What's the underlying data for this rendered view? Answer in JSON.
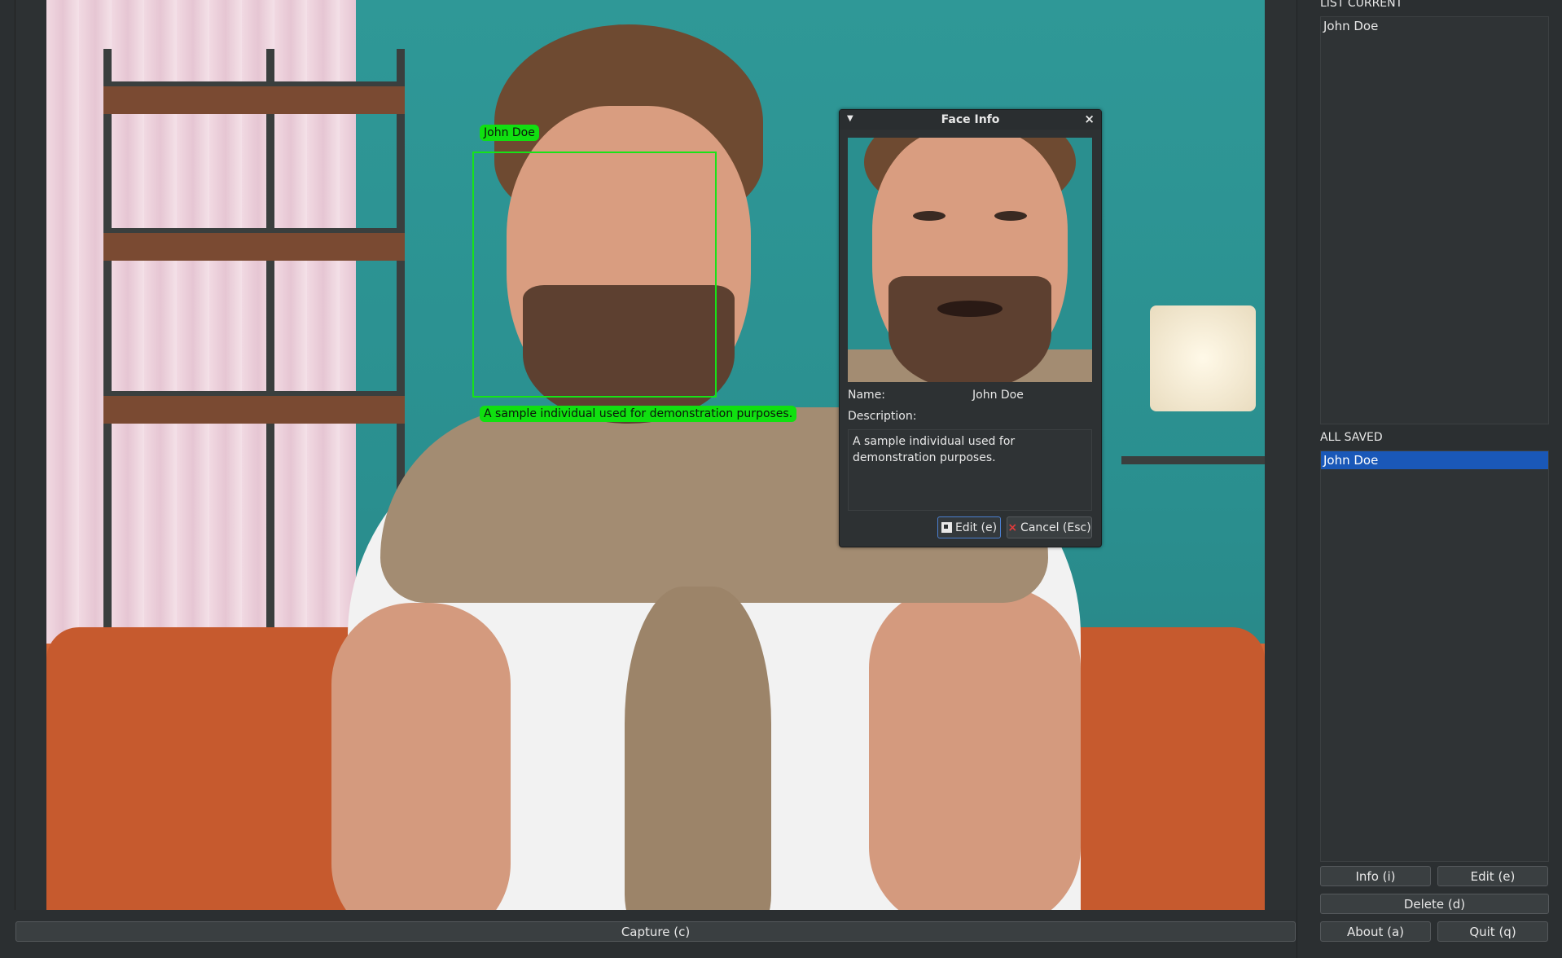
{
  "video": {
    "overlay_name": "John Doe",
    "overlay_desc": "A sample individual used for demonstration purposes."
  },
  "capture": {
    "label": "Capture (c)"
  },
  "panel": {
    "list_current_label": "LIST CURRENT",
    "list_current": [
      "John Doe"
    ],
    "all_saved_label": "ALL SAVED",
    "all_saved": [
      {
        "name": "John Doe",
        "selected": true
      }
    ],
    "buttons": {
      "info": "Info (i)",
      "edit": "Edit (e)",
      "delete": "Delete (d)",
      "about": "About (a)",
      "quit": "Quit (q)"
    }
  },
  "dialog": {
    "title": "Face Info",
    "name_label": "Name:",
    "name_value": "John Doe",
    "description_label": "Description:",
    "description_value": "A sample individual used for demonstration purposes.",
    "edit_button": "Edit (e)",
    "cancel_button": "Cancel (Esc)"
  },
  "colors": {
    "overlay_green": "#10e010",
    "selection_blue": "#1a58b8",
    "background": "#2b2f31"
  },
  "icons": {
    "dialog_menu": "triangle-down-icon",
    "dialog_close": "close-icon",
    "edit": "edit-icon",
    "cancel": "x-icon"
  }
}
